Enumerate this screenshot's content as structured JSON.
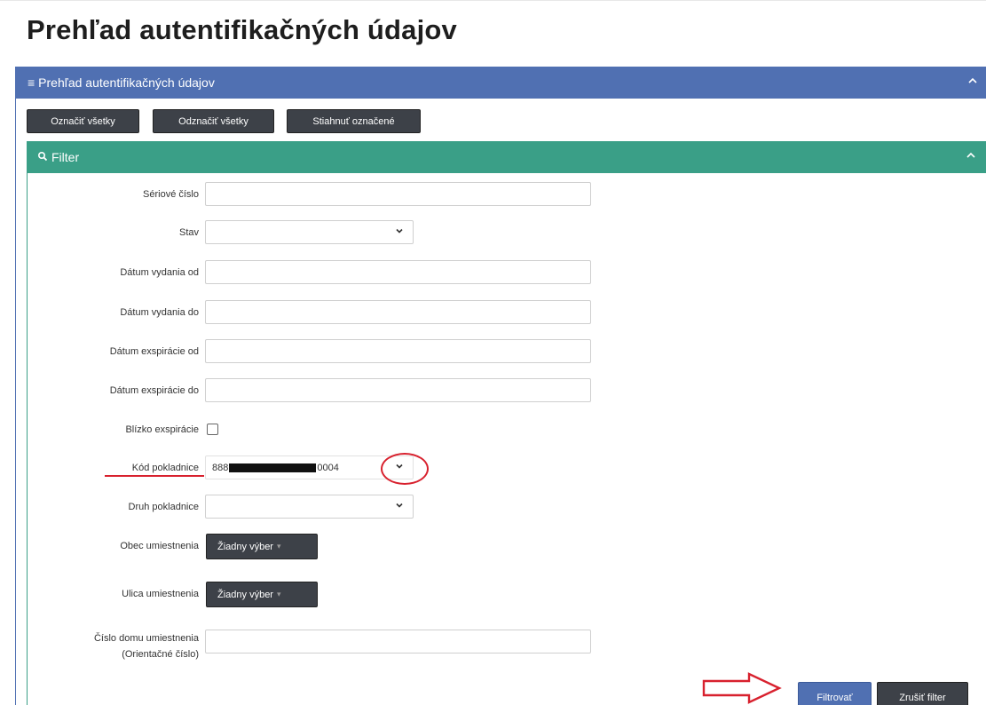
{
  "page": {
    "title": "Prehľad autentifikačných údajov"
  },
  "panel": {
    "title": "Prehľad autentifikačných údajov",
    "menu_icon": "hamburger-icon",
    "collapse_icon": "chevron-up-icon"
  },
  "toolbar": {
    "select_all": "Označiť všetky",
    "deselect_all": "Odznačiť všetky",
    "download_selected": "Stiahnuť označené"
  },
  "filter": {
    "title": "Filter",
    "icon": "search-icon",
    "collapse_icon": "chevron-up-icon",
    "fields": {
      "serial_number": {
        "label": "Sériové číslo",
        "value": ""
      },
      "status": {
        "label": "Stav",
        "value": ""
      },
      "issue_date_from": {
        "label": "Dátum vydania od",
        "value": ""
      },
      "issue_date_to": {
        "label": "Dátum vydania do",
        "value": ""
      },
      "expiry_date_from": {
        "label": "Dátum exspirácie od",
        "value": ""
      },
      "expiry_date_to": {
        "label": "Dátum exspirácie do",
        "value": ""
      },
      "near_expiry": {
        "label": "Blízko exspirácie",
        "checked": false
      },
      "register_code": {
        "label": "Kód pokladnice",
        "value_prefix": "888",
        "value_suffix": "0004"
      },
      "register_type": {
        "label": "Druh pokladnice",
        "value": ""
      },
      "municipality": {
        "label": "Obec umiestnenia",
        "button": "Žiadny výber"
      },
      "street": {
        "label": "Ulica umiestnenia",
        "button": "Žiadny výber"
      },
      "house_number": {
        "label_line1": "Číslo domu umiestnenia",
        "label_line2": "(Orientačné číslo)",
        "value": ""
      }
    },
    "buttons": {
      "apply": "Filtrovať",
      "clear": "Zrušiť filter"
    }
  },
  "annotations": {
    "color": "#d8212e",
    "accent_blue": "#5070b2",
    "accent_green": "#3a9f87"
  }
}
